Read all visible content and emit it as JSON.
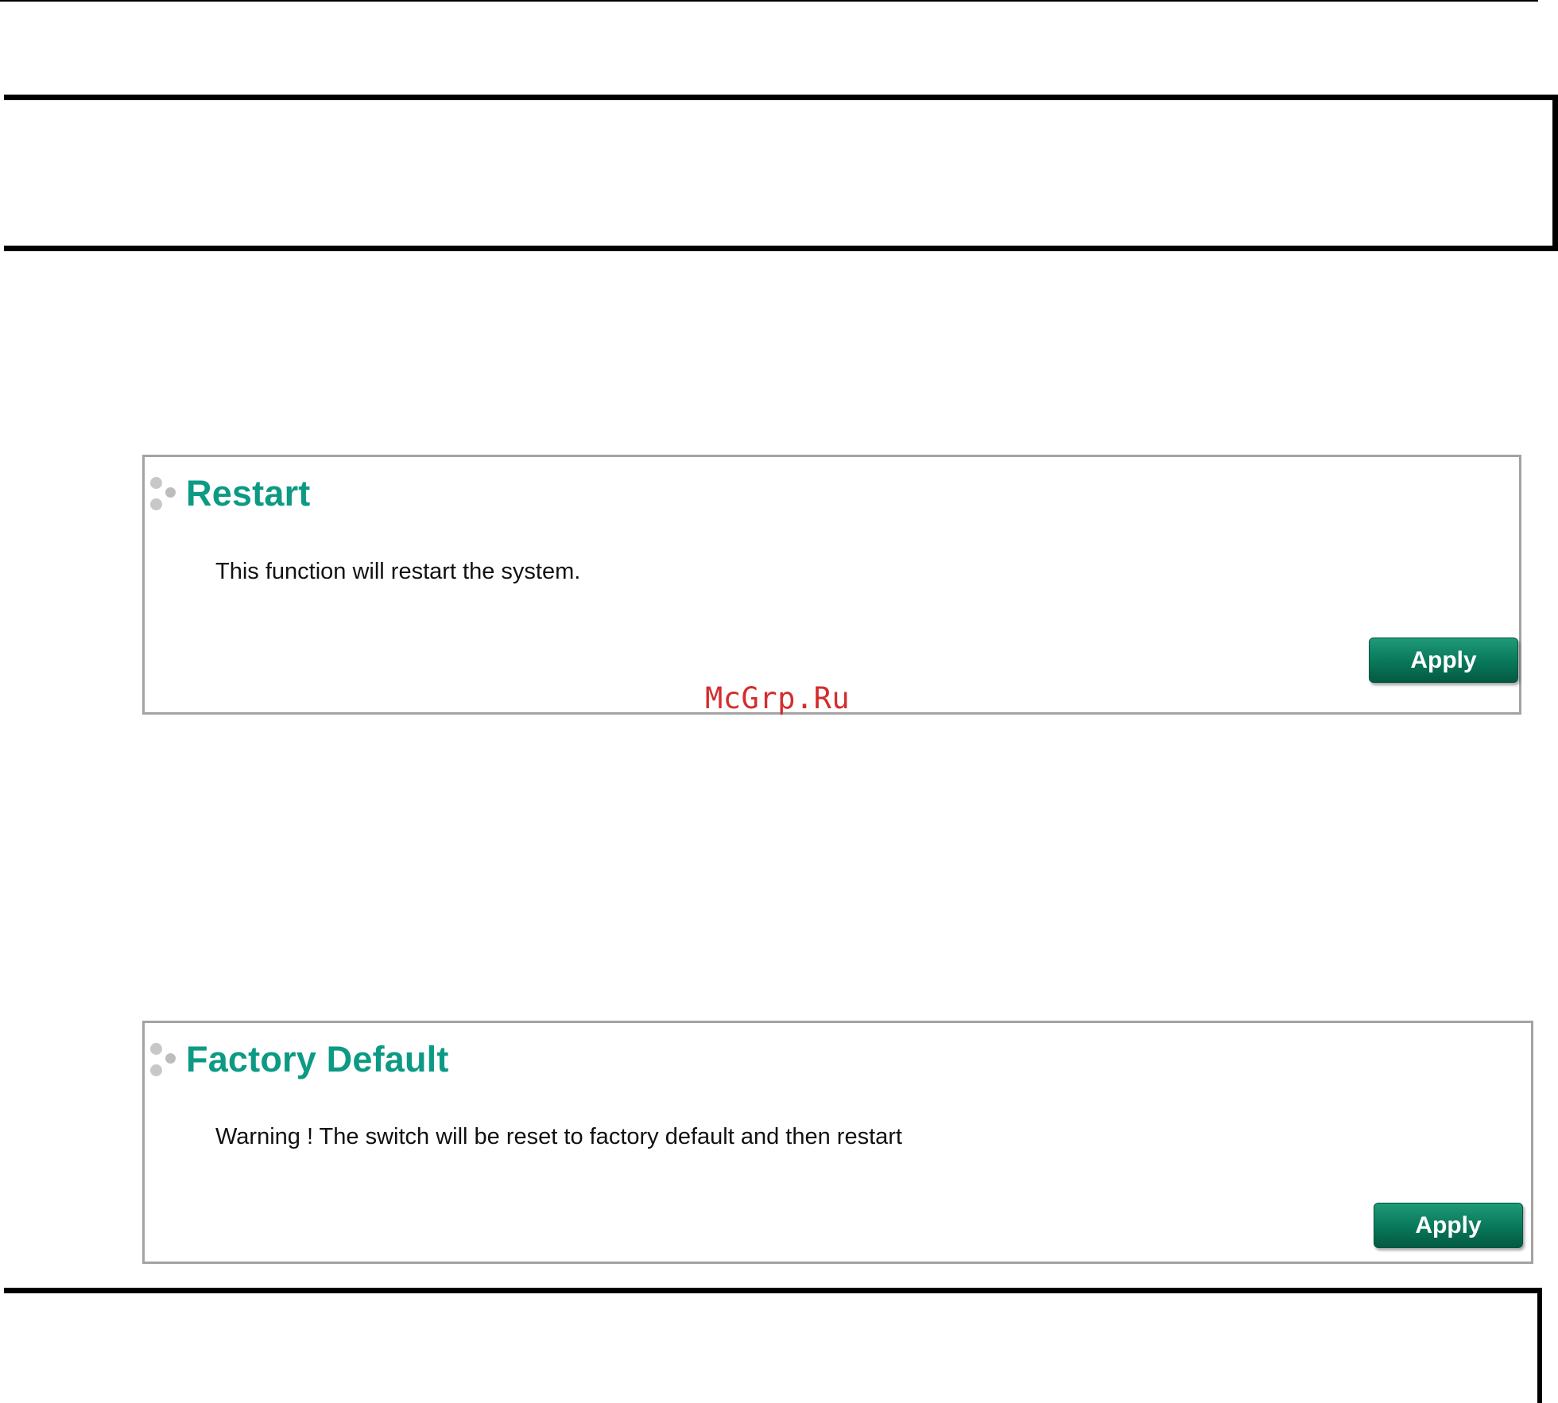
{
  "restart": {
    "icon": "bullet-dots-icon",
    "title": "Restart",
    "description": "This function will restart the system.",
    "apply_label": "Apply"
  },
  "factory_default": {
    "icon": "bullet-dots-icon",
    "title": "Factory Default",
    "description": "Warning ! The switch will be reset to factory default and then restart",
    "apply_label": "Apply"
  },
  "watermark": "McGrp.Ru",
  "colors": {
    "title": "#0c9a84",
    "button": "#0a7a5c",
    "watermark": "#d42d2d",
    "panel_border": "#a3a3a3"
  }
}
